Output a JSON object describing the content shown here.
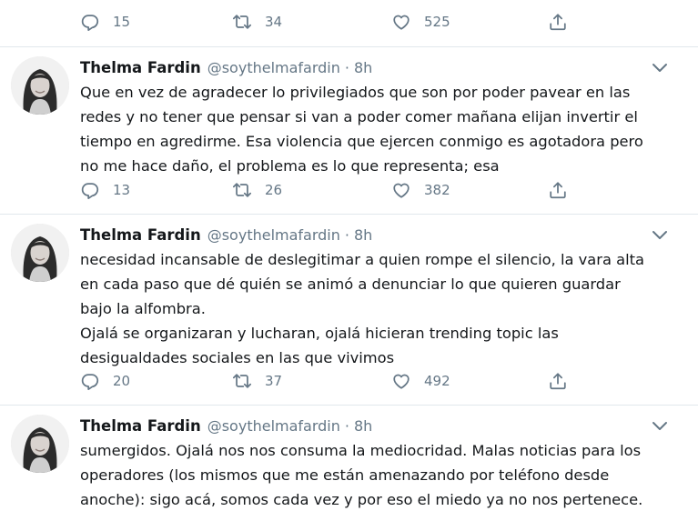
{
  "tweets_top_actions": {
    "replies": "15",
    "retweets": "34",
    "likes": "525"
  },
  "tweets": [
    {
      "name": "Thelma Fardin",
      "handle": "@soythelmafardin",
      "separator": "·",
      "time": "8h",
      "text": "Que en vez de agradecer lo privilegiados que son por poder pavear en las\nredes y no tener que pensar si van a poder comer mañana elijan invertir el\ntiempo en agredirme. Esa violencia que ejercen conmigo es agotadora pero\nno me hace daño, el problema es lo que representa; esa",
      "replies": "13",
      "retweets": "26",
      "likes": "382"
    },
    {
      "name": "Thelma Fardin",
      "handle": "@soythelmafardin",
      "separator": "·",
      "time": "8h",
      "text": "necesidad incansable de deslegitimar a quien rompe el silencio, la vara alta\nen cada paso que dé quién se animó a denunciar lo que quieren guardar\nbajo la alfombra.\nOjalá se organizaran y lucharan, ojalá hicieran trending topic las\ndesigualdades sociales en las que vivimos",
      "replies": "20",
      "retweets": "37",
      "likes": "492"
    },
    {
      "name": "Thelma Fardin",
      "handle": "@soythelmafardin",
      "separator": "·",
      "time": "8h",
      "text": "sumergidos. Ojalá nos nos consuma la mediocridad. Malas noticias para los\noperadores (los mismos que me están amenazando por teléfono desde\nanoche): sigo acá, somos cada vez y por eso el miedo ya no nos pertenece."
    }
  ],
  "icons": [
    "reply-icon",
    "retweet-icon",
    "like-icon",
    "share-icon",
    "chevron-down-icon"
  ],
  "colors": {
    "muted": "#657786",
    "text": "#14171a",
    "divider": "#e1e8ed"
  }
}
